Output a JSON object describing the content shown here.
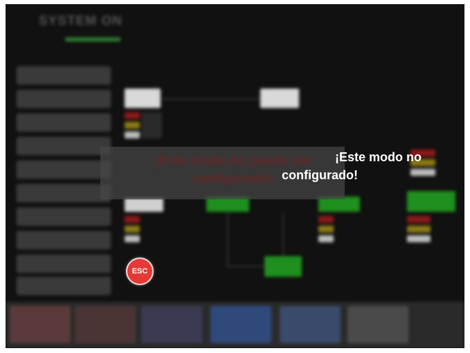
{
  "header": {
    "title": "SYSTEM ON"
  },
  "modal": {
    "message_overlay": "¡Este modo no puede ser configurado!",
    "message_line1": "¡Este modo no",
    "message_line2": "configurado!"
  },
  "esc_button": {
    "label": "ESC"
  },
  "colors": {
    "background": "#111111",
    "status_green": "#2e7d32",
    "esc_red": "#e53935",
    "message_white": "#ffffff"
  }
}
